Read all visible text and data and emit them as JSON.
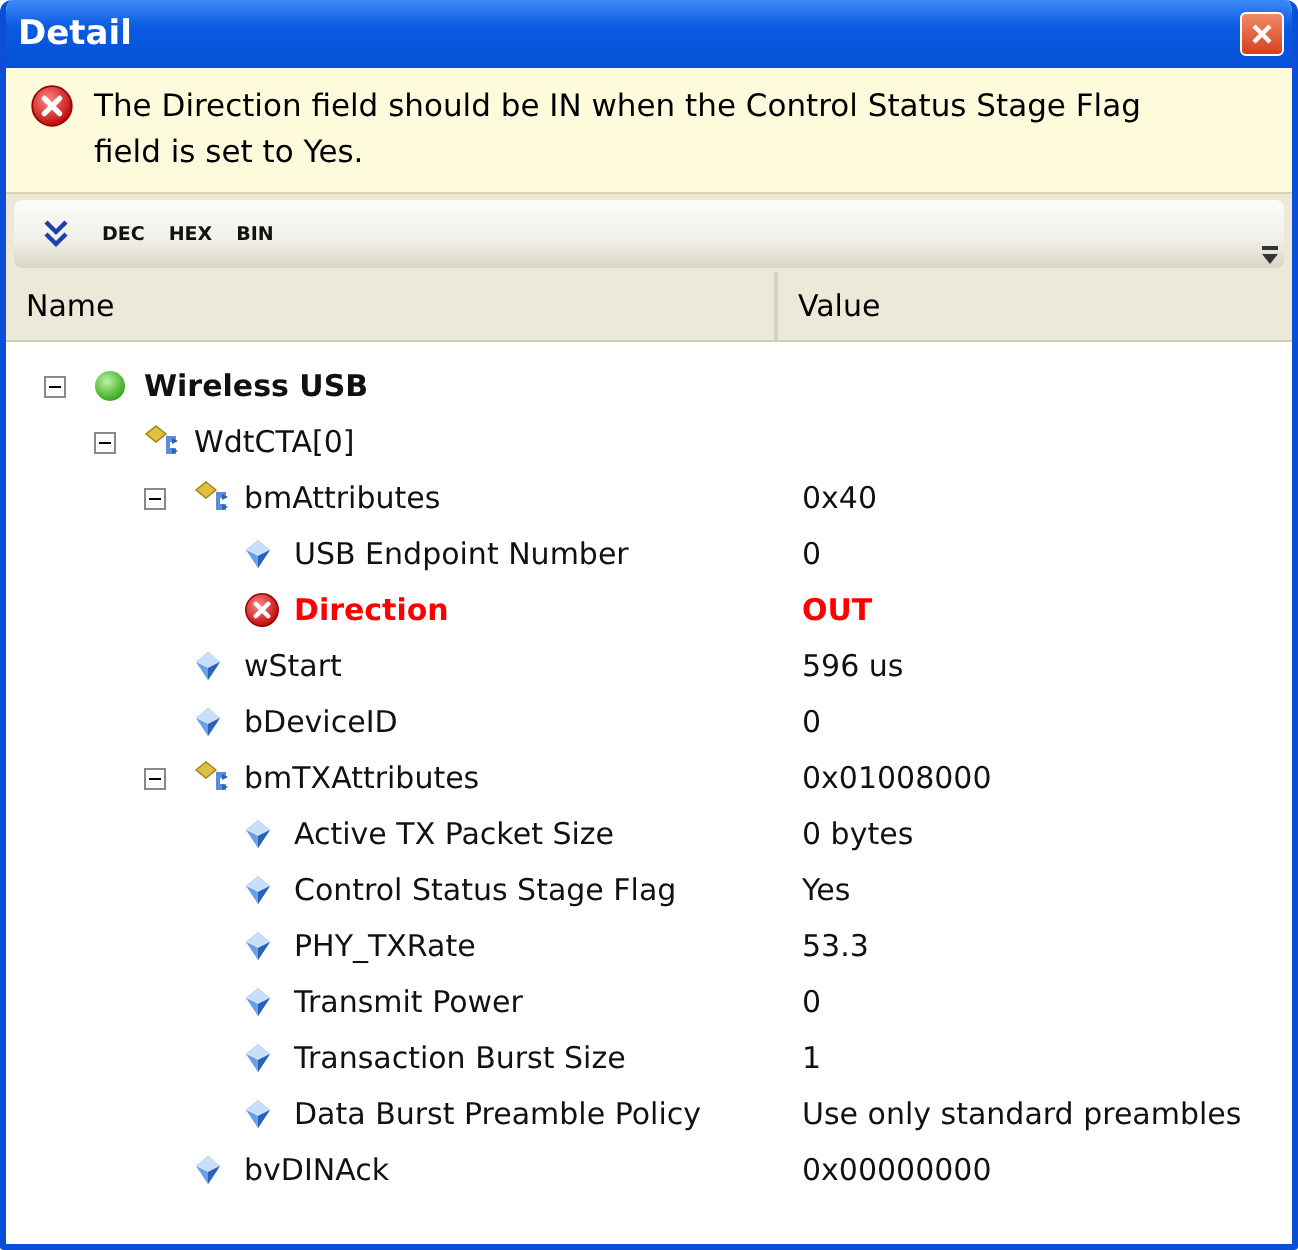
{
  "window": {
    "title": "Detail"
  },
  "message": {
    "kind": "error",
    "text": "The Direction field should be IN when the Control Status Stage Flag field is set to Yes."
  },
  "toolbar": {
    "buttons": [
      "DEC",
      "HEX",
      "BIN"
    ]
  },
  "columns": [
    "Name",
    "Value"
  ],
  "tree": [
    {
      "kind": "root",
      "name": "Wireless USB",
      "expanded": true,
      "children": [
        {
          "kind": "group",
          "name": "WdtCTA[0]",
          "expanded": true,
          "children": [
            {
              "kind": "group",
              "name": "bmAttributes",
              "value": "0x40",
              "expanded": true,
              "children": [
                {
                  "kind": "field",
                  "name": "USB Endpoint Number",
                  "value": "0"
                },
                {
                  "kind": "error",
                  "name": "Direction",
                  "value": "OUT"
                }
              ]
            },
            {
              "kind": "field",
              "name": "wStart",
              "value": "596 us"
            },
            {
              "kind": "field",
              "name": "bDeviceID",
              "value": "0"
            },
            {
              "kind": "group",
              "name": "bmTXAttributes",
              "value": "0x01008000",
              "expanded": true,
              "children": [
                {
                  "kind": "field",
                  "name": "Active TX Packet Size",
                  "value": "0 bytes"
                },
                {
                  "kind": "field",
                  "name": "Control Status Stage Flag",
                  "value": "Yes"
                },
                {
                  "kind": "field",
                  "name": "PHY_TXRate",
                  "value": "53.3"
                },
                {
                  "kind": "field",
                  "name": "Transmit Power",
                  "value": "0"
                },
                {
                  "kind": "field",
                  "name": "Transaction Burst Size",
                  "value": "1"
                },
                {
                  "kind": "field",
                  "name": "Data Burst Preamble Policy",
                  "value": "Use only standard preambles"
                }
              ]
            },
            {
              "kind": "field",
              "name": "bvDINAck",
              "value": "0x00000000"
            }
          ]
        }
      ]
    }
  ]
}
